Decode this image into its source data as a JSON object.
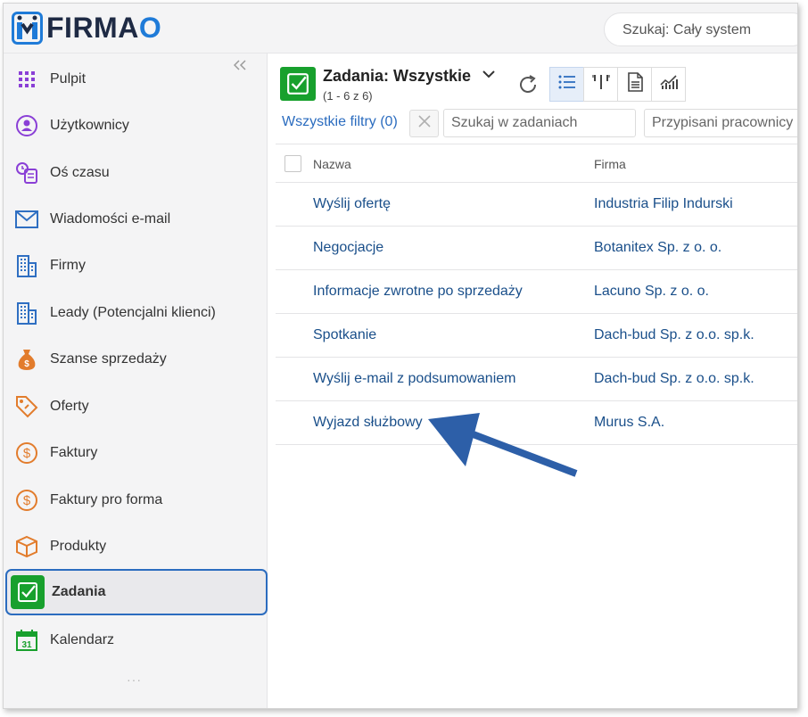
{
  "brand": {
    "name_main": "FIRMA",
    "name_accent": "O",
    "colors": {
      "accent": "#1f7bd8",
      "dark": "#1e2a44",
      "success": "#18a02d",
      "link": "#1a4f8a",
      "active_border": "#2b6cbf"
    }
  },
  "header": {
    "search_placeholder": "Szukaj: Cały system"
  },
  "sidebar": {
    "collapse_label": "«",
    "items": [
      {
        "label": "Pulpit",
        "icon": "grid-icon"
      },
      {
        "label": "Użytkownicy",
        "icon": "users-icon"
      },
      {
        "label": "Oś czasu",
        "icon": "timeline-icon"
      },
      {
        "label": "Wiadomości e-mail",
        "icon": "mail-icon"
      },
      {
        "label": "Firmy",
        "icon": "building-icon"
      },
      {
        "label": "Leady (Potencjalni klienci)",
        "icon": "building-icon"
      },
      {
        "label": "Szanse sprzedaży",
        "icon": "money-bag-icon"
      },
      {
        "label": "Oferty",
        "icon": "tag-icon"
      },
      {
        "label": "Faktury",
        "icon": "dollar-coin-icon"
      },
      {
        "label": "Faktury pro forma",
        "icon": "dollar-coin-icon"
      },
      {
        "label": "Produkty",
        "icon": "box-icon"
      },
      {
        "label": "Zadania",
        "icon": "task-check-icon",
        "active": true
      },
      {
        "label": "Kalendarz",
        "icon": "calendar-icon",
        "calendar_day": "31"
      }
    ],
    "more_label": "···"
  },
  "main": {
    "title": "Zadania: Wszystkie",
    "subtitle": "(1 - 6 z 6)",
    "filters_label": "Wszystkie filtry (0)",
    "task_search_placeholder": "Szukaj w zadaniach",
    "assigned_placeholder": "Przypisani pracownicy",
    "columns": {
      "name": "Nazwa",
      "firm": "Firma"
    },
    "rows": [
      {
        "name": "Wyślij ofertę",
        "firm": "Industria Filip Indurski"
      },
      {
        "name": "Negocjacje",
        "firm": "Botanitex Sp. z o. o."
      },
      {
        "name": "Informacje zwrotne po sprzedaży",
        "firm": "Lacuno Sp. z o. o."
      },
      {
        "name": "Spotkanie",
        "firm": "Dach-bud Sp. z o.o. sp.k."
      },
      {
        "name": "Wyślij e-mail z podsumowaniem",
        "firm": "Dach-bud Sp. z o.o. sp.k."
      },
      {
        "name": "Wyjazd służbowy",
        "firm": "Murus S.A."
      }
    ]
  }
}
